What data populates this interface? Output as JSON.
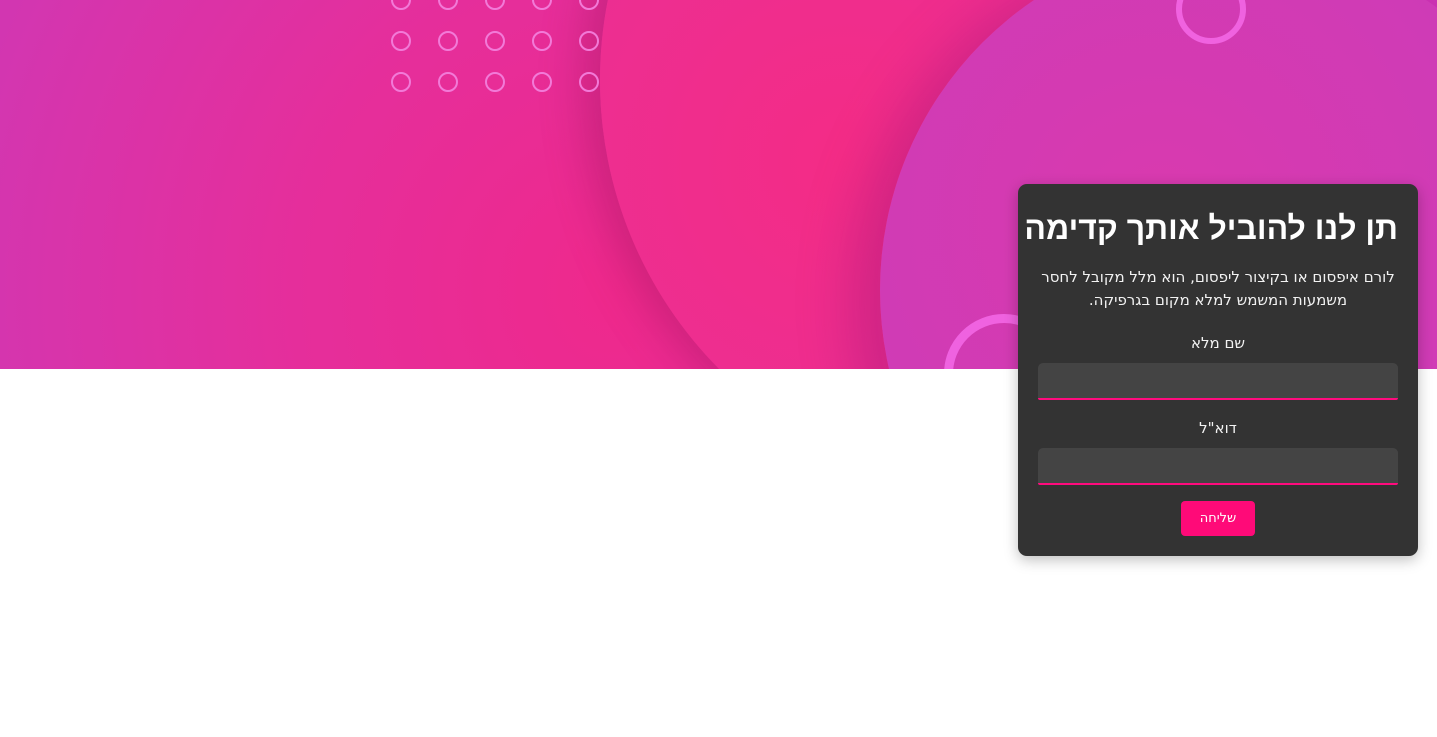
{
  "hero": {
    "decoration_colors": {
      "background": "#c53ac4",
      "blob_pink": "#f0288a",
      "ring": "#f56ae8",
      "dots": "#f27ad8"
    }
  },
  "form_card": {
    "title": "תן לנו להוביל אותך קדימה",
    "description": "לורם איפסום או בקיצור ליפסום, הוא מלל מקובל לחסר משמעות המשמש למלא מקום בגרפיקה.",
    "fields": [
      {
        "label": "שם מלא",
        "value": "",
        "placeholder": ""
      },
      {
        "label": "דוא\"ל",
        "value": "",
        "placeholder": ""
      }
    ],
    "submit_label": "שליחה",
    "colors": {
      "card_background": "#333333",
      "input_background": "#444444",
      "accent": "#ff0a78"
    }
  }
}
